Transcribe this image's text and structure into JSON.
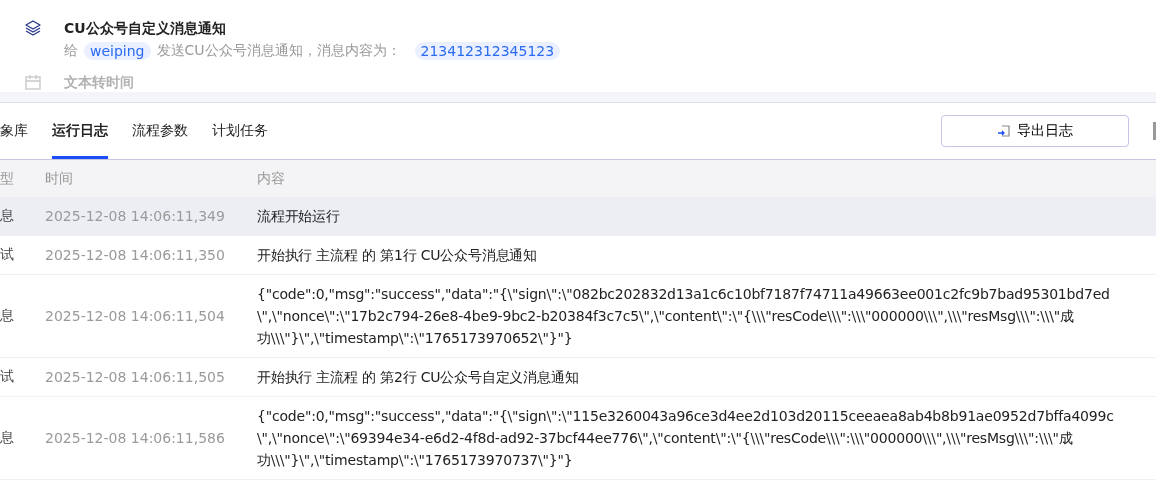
{
  "nodes": [
    {
      "title": "CU公众号自定义消息通知",
      "description": [
        {
          "kind": "text",
          "text": "给"
        },
        {
          "kind": "tag",
          "text": "weiping"
        },
        {
          "kind": "text",
          "text": "发送CU公众号消息通知，消息内容为："
        },
        {
          "kind": "tag",
          "text": "213412312345123"
        }
      ],
      "faded": false
    },
    {
      "title": "文本转时间",
      "faded": true
    }
  ],
  "tabs": [
    {
      "label": "象库",
      "selected": false
    },
    {
      "label": "运行日志",
      "selected": true
    },
    {
      "label": "流程参数",
      "selected": false
    },
    {
      "label": "计划任务",
      "selected": false
    }
  ],
  "export_button": "导出日志",
  "table": {
    "columns": [
      "型",
      "时间",
      "内容"
    ],
    "rows": [
      {
        "type": "息",
        "time": "2025-12-08 14:06:11,349",
        "content": [
          "流程开始运行"
        ],
        "selected": true
      },
      {
        "type": "试",
        "time": "2025-12-08 14:06:11,350",
        "content": [
          "开始执行 主流程 的 第1行 CU公众号消息通知"
        ],
        "selected": false
      },
      {
        "type": "息",
        "time": "2025-12-08 14:06:11,504",
        "content": [
          "{\"code\":0,\"msg\":\"success\",\"data\":\"{\\\"sign\\\":\\\"082bc202832d13a1c6c10bf7187f74711a49663ee001c2fc9b7bad95301bd7ed",
          "\\\",\\\"nonce\\\":\\\"17b2c794-26e8-4be9-9bc2-b20384f3c7c5\\\",\\\"content\\\":\\\"{\\\\\\\"resCode\\\\\\\":\\\\\\\"000000\\\\\\\",\\\\\\\"resMsg\\\\\\\":\\\\\\\"成",
          "功\\\\\\\"}\\\",\\\"timestamp\\\":\\\"1765173970652\\\"}\"}"
        ],
        "selected": false
      },
      {
        "type": "试",
        "time": "2025-12-08 14:06:11,505",
        "content": [
          "开始执行 主流程 的 第2行 CU公众号自定义消息通知"
        ],
        "selected": false
      },
      {
        "type": "息",
        "time": "2025-12-08 14:06:11,586",
        "content": [
          "{\"code\":0,\"msg\":\"success\",\"data\":\"{\\\"sign\\\":\\\"115e3260043a96ce3d4ee2d103d20115ceeaea8ab4b8b91ae0952d7bffa4099c",
          "\\\",\\\"nonce\\\":\\\"69394e34-e6d2-4f8d-ad92-37bcf44ee776\\\",\\\"content\\\":\\\"{\\\\\\\"resCode\\\\\\\":\\\\\\\"000000\\\\\\\",\\\\\\\"resMsg\\\\\\\":\\\\\\\"成",
          "功\\\\\\\"}\\\",\\\"timestamp\\\":\\\"1765173970737\\\"}\"}"
        ],
        "selected": false
      }
    ]
  }
}
